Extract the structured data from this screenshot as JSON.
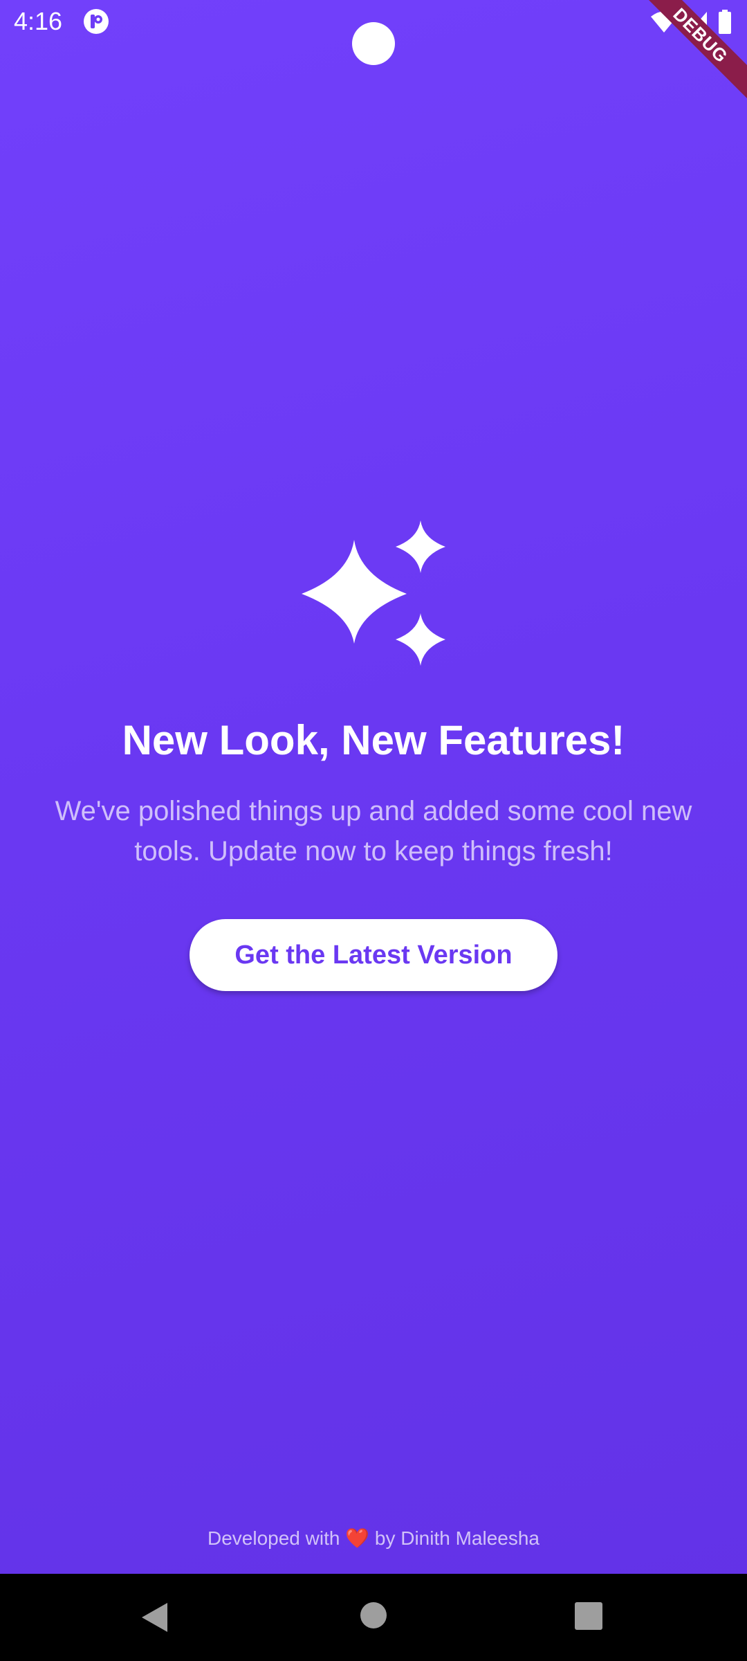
{
  "status_bar": {
    "time": "4:16",
    "debug_label": "DEBUG",
    "icons": [
      "app-notification-icon",
      "wifi-icon",
      "cell-signal-icon",
      "battery-icon"
    ]
  },
  "main": {
    "icon": "sparkles-icon",
    "headline": "New Look, New Features!",
    "subtext": "We've polished things up and added some cool new tools. Update now to keep things fresh!",
    "cta_label": "Get the Latest Version"
  },
  "footer": {
    "prefix": "Developed with",
    "heart": "❤️",
    "suffix": "by Dinith Maleesha"
  },
  "nav_bar": {
    "icons": [
      "back-icon",
      "home-icon",
      "recents-icon"
    ]
  },
  "colors": {
    "background": "#6a38f2",
    "accent": "#6a38f2",
    "button_bg": "#ffffff",
    "debug_ribbon": "#8b1d4a",
    "nav_bar": "#000000"
  }
}
